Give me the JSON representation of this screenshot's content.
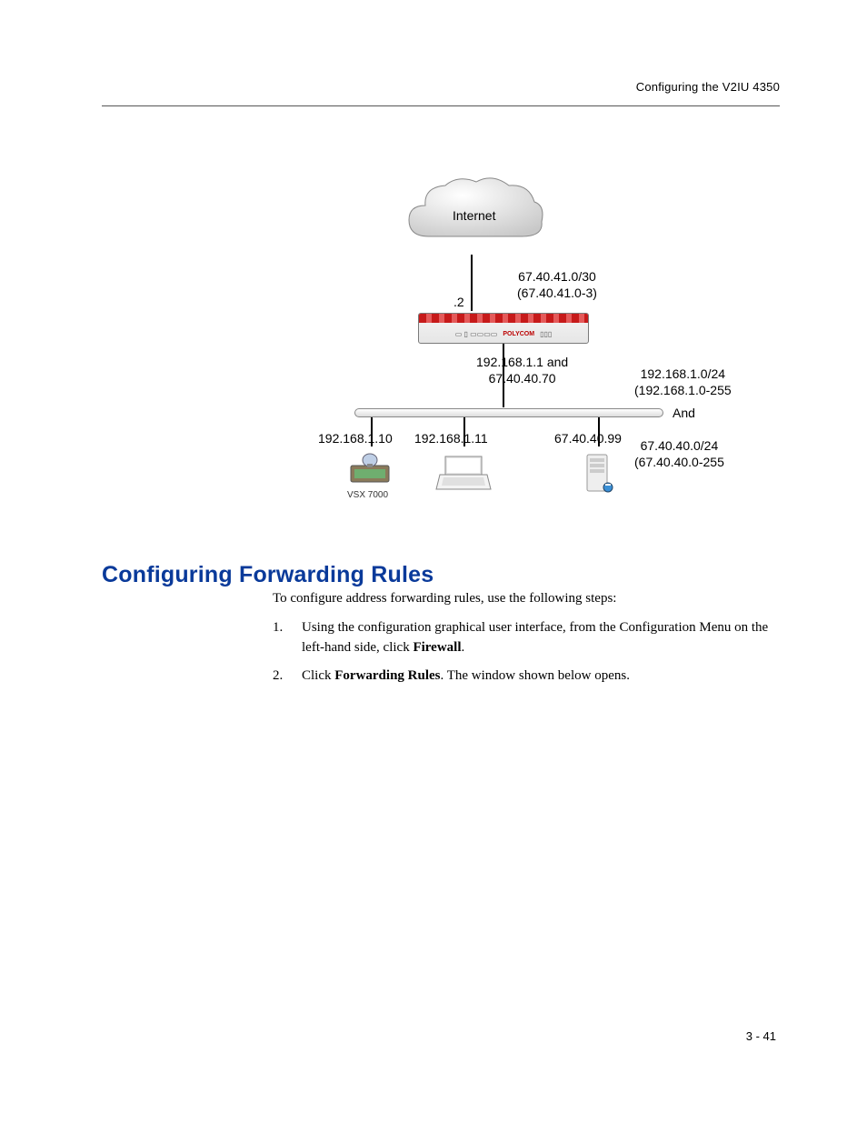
{
  "header": {
    "right": "Configuring the V2IU 4350"
  },
  "diagram": {
    "cloud_label": "Internet",
    "wan_subnet_line1": "67.40.41.0/30",
    "wan_subnet_line2": "(67.40.41.0-3)",
    "wan_host": ".2",
    "router_brand": "POLYCOM",
    "router_ip_line1": "192.168.1.1 and",
    "router_ip_line2": "67.40.40.70",
    "lan_subnet1_line1": "192.168.1.0/24",
    "lan_subnet1_line2": "(192.168.1.0-255",
    "and_label": "And",
    "lan_subnet2_line1": "67.40.40.0/24",
    "lan_subnet2_line2": "(67.40.40.0-255",
    "host1_ip": "192.168.1.10",
    "host2_ip": "192.168.1.11",
    "host3_ip": "67.40.40.99",
    "host1_label": "VSX 7000"
  },
  "section": {
    "title": "Configuring Forwarding Rules"
  },
  "body": {
    "intro": "To configure address forwarding rules, use the following steps:",
    "step1_num": "1.",
    "step1_a": "Using the configuration graphical user interface, from the Configuration Menu on the left-hand side, click ",
    "step1_b": "Firewall",
    "step1_c": ".",
    "step2_num": "2.",
    "step2_a": "Click ",
    "step2_b": "Forwarding Rules",
    "step2_c": ". The window shown below opens."
  },
  "footer": {
    "page": "3 - 41"
  }
}
